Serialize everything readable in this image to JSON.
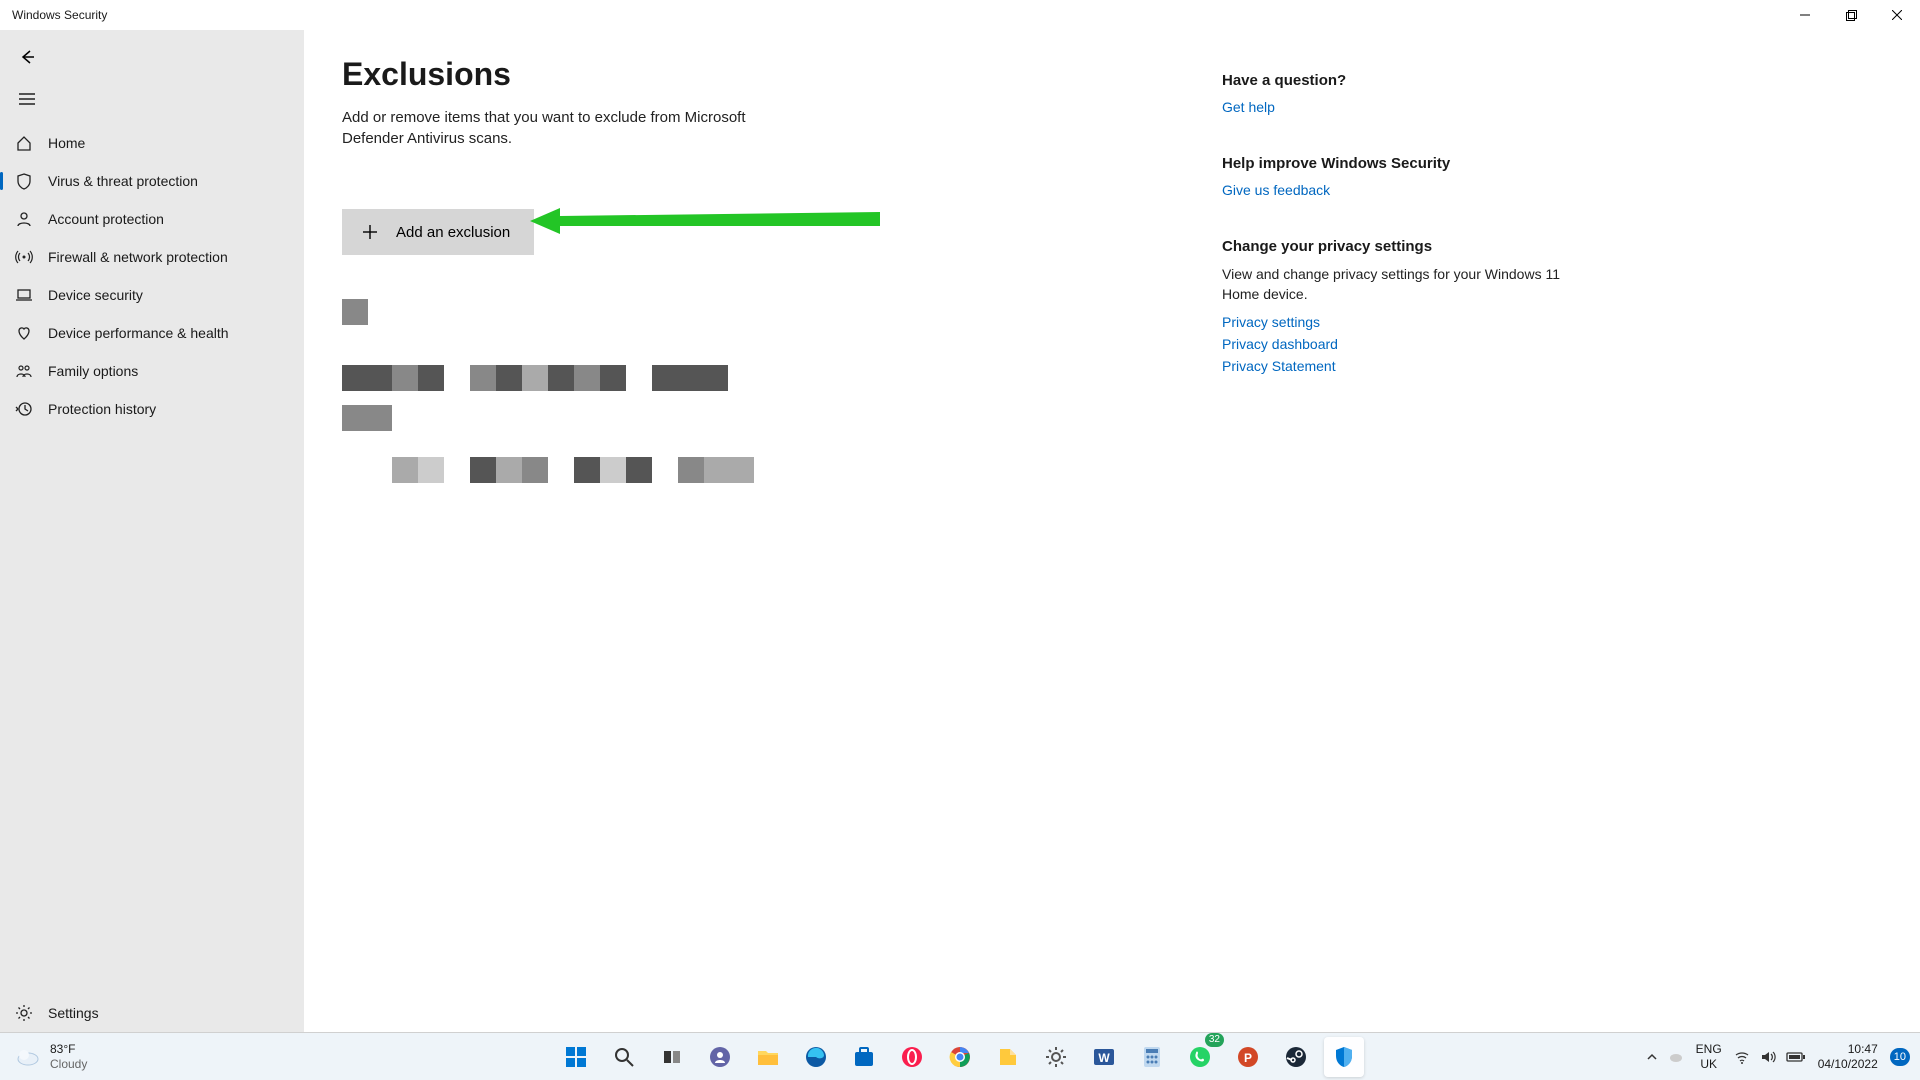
{
  "window": {
    "title": "Windows Security"
  },
  "sidebar": {
    "items": [
      {
        "label": "Home",
        "icon": "home-icon"
      },
      {
        "label": "Virus & threat protection",
        "icon": "shield-icon",
        "active": true
      },
      {
        "label": "Account protection",
        "icon": "person-icon"
      },
      {
        "label": "Firewall & network protection",
        "icon": "antenna-icon"
      },
      {
        "label": "Device security",
        "icon": "laptop-icon"
      },
      {
        "label": "Device performance & health",
        "icon": "heart-icon"
      },
      {
        "label": "Family options",
        "icon": "family-icon"
      },
      {
        "label": "Protection history",
        "icon": "history-icon"
      }
    ],
    "settings_label": "Settings"
  },
  "page": {
    "title": "Exclusions",
    "subtitle": "Add or remove items that you want to exclude from Microsoft Defender Antivirus scans.",
    "add_button": "Add an exclusion"
  },
  "aside": {
    "question_heading": "Have a question?",
    "get_help": "Get help",
    "improve_heading": "Help improve Windows Security",
    "feedback": "Give us feedback",
    "privacy_heading": "Change your privacy settings",
    "privacy_desc": "View and change privacy settings for your Windows 11 Home device.",
    "privacy_settings": "Privacy settings",
    "privacy_dashboard": "Privacy dashboard",
    "privacy_statement": "Privacy Statement"
  },
  "taskbar": {
    "weather_temp": "83°F",
    "weather_desc": "Cloudy",
    "lang1": "ENG",
    "lang2": "UK",
    "time": "10:47",
    "date": "04/10/2022",
    "notif_count": "10",
    "whatsapp_badge": "32"
  }
}
